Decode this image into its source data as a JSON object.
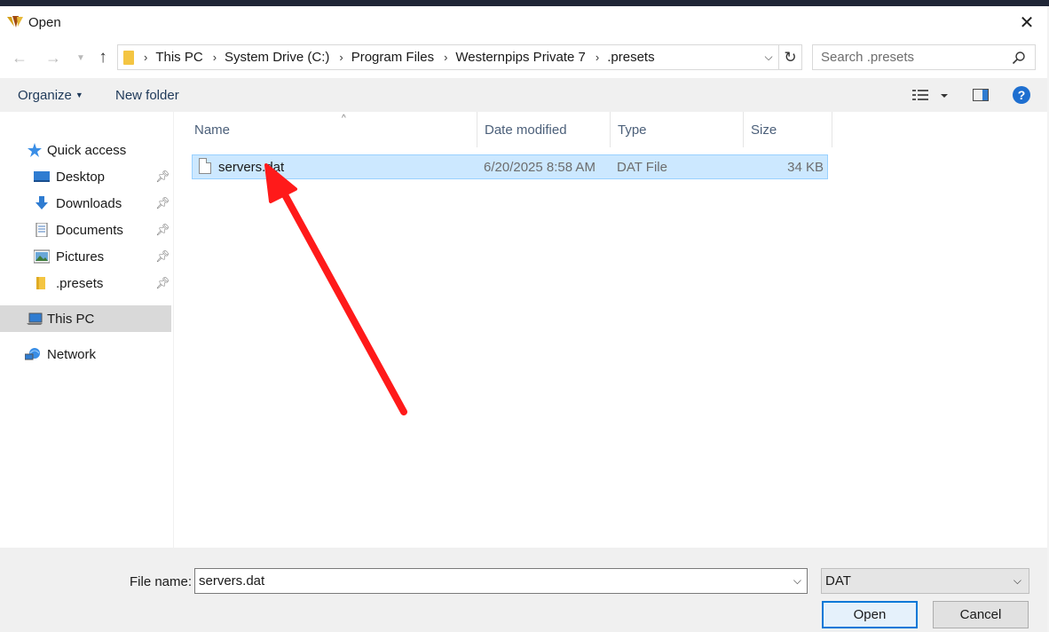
{
  "window": {
    "title": "Open"
  },
  "nav": {
    "breadcrumbs": [
      "This PC",
      "System Drive (C:)",
      "Program Files",
      "Westernpips Private 7",
      ".presets"
    ],
    "search_placeholder": "Search .presets"
  },
  "commandbar": {
    "organize_label": "Organize",
    "new_folder_label": "New folder"
  },
  "navpane": {
    "items": [
      {
        "label": "Quick access",
        "icon": "star-icon",
        "pinned": false
      },
      {
        "label": "Desktop",
        "icon": "desktop-icon",
        "pinned": true
      },
      {
        "label": "Downloads",
        "icon": "download-icon",
        "pinned": true
      },
      {
        "label": "Documents",
        "icon": "document-icon",
        "pinned": true
      },
      {
        "label": "Pictures",
        "icon": "pictures-icon",
        "pinned": true
      },
      {
        "label": ".presets",
        "icon": "folder-icon",
        "pinned": true
      },
      {
        "label": "This PC",
        "icon": "computer-icon",
        "pinned": false,
        "selected": true
      },
      {
        "label": "Network",
        "icon": "network-icon",
        "pinned": false
      }
    ]
  },
  "filelist": {
    "columns": [
      "Name",
      "Date modified",
      "Type",
      "Size"
    ],
    "rows": [
      {
        "name": "servers.dat",
        "date_modified": "6/20/2025 8:58 AM",
        "type": "DAT File",
        "size": "34 KB",
        "selected": true
      }
    ]
  },
  "bottom": {
    "file_name_label": "File name:",
    "file_name_value": "servers.dat",
    "file_type_value": "DAT",
    "open_label": "Open",
    "cancel_label": "Cancel"
  },
  "colors": {
    "selection": "#cce8ff",
    "accent": "#0078d7",
    "annotation_arrow": "#ff1a1a"
  }
}
